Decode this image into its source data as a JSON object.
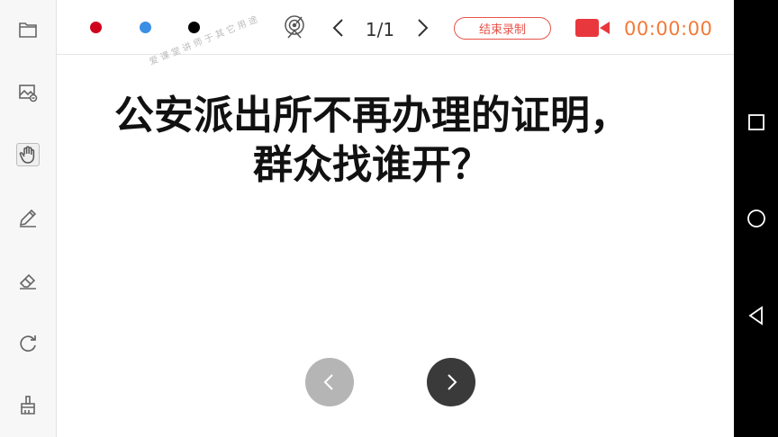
{
  "toolbar": {
    "tools": [
      {
        "name": "folder-icon"
      },
      {
        "name": "image-icon"
      },
      {
        "name": "hand-icon"
      },
      {
        "name": "pen-icon"
      },
      {
        "name": "eraser-icon"
      },
      {
        "name": "undo-icon"
      },
      {
        "name": "brush-icon"
      }
    ],
    "active_tool": "hand-icon"
  },
  "topbar": {
    "colors": [
      "#d0021b",
      "#3b8fe4",
      "#000000"
    ],
    "page_indicator": "1/1",
    "end_record_label": "结束录制",
    "timer": "00:00:00",
    "accent": "#e8524a",
    "timer_color": "#f27a38"
  },
  "slide": {
    "title_line1": "公安派出所不再办理的证明，",
    "title_line2": "群众找谁开？",
    "watermark": "爱 课 堂 讲 师 于 其 它 用 途"
  },
  "system_nav": [
    "recents-icon",
    "home-icon",
    "back-icon"
  ]
}
